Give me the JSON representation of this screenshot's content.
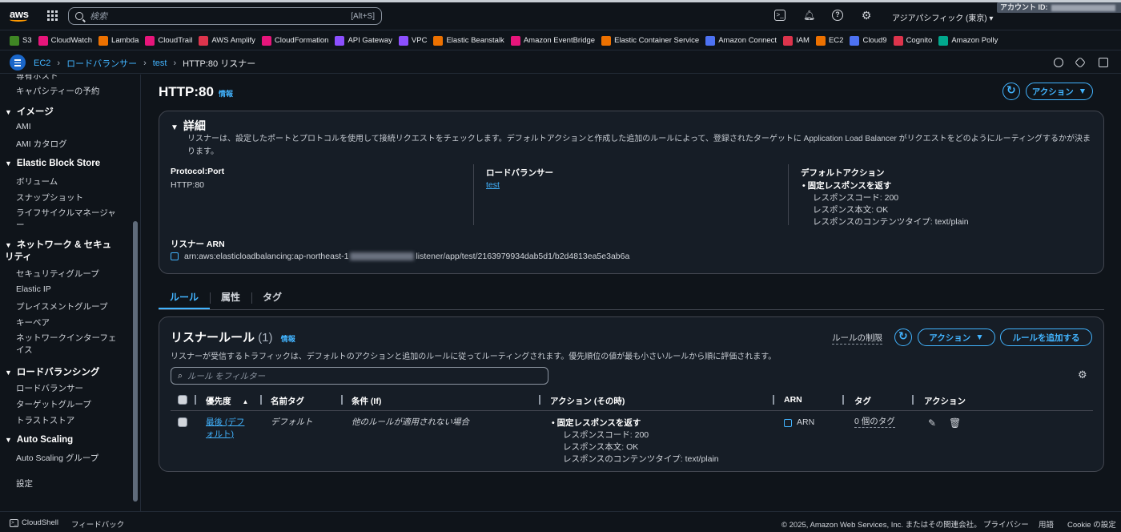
{
  "topbar": {
    "logo": "aws",
    "search_placeholder": "検索",
    "search_shortcut": "[Alt+S]",
    "region": "アジアパシフィック (東京) ▾",
    "account_label": "アカウント ID:"
  },
  "favorites": [
    {
      "label": "S3",
      "color": "#3f8624"
    },
    {
      "label": "CloudWatch",
      "color": "#e7157b"
    },
    {
      "label": "Lambda",
      "color": "#ed7100"
    },
    {
      "label": "CloudTrail",
      "color": "#e7157b"
    },
    {
      "label": "AWS Amplify",
      "color": "#dd344c"
    },
    {
      "label": "CloudFormation",
      "color": "#e7157b"
    },
    {
      "label": "API Gateway",
      "color": "#8c4fff"
    },
    {
      "label": "VPC",
      "color": "#8c4fff"
    },
    {
      "label": "Elastic Beanstalk",
      "color": "#ed7100"
    },
    {
      "label": "Amazon EventBridge",
      "color": "#e7157b"
    },
    {
      "label": "Elastic Container Service",
      "color": "#ed7100"
    },
    {
      "label": "Amazon Connect",
      "color": "#4d72f3"
    },
    {
      "label": "IAM",
      "color": "#dd344c"
    },
    {
      "label": "EC2",
      "color": "#ed7100"
    },
    {
      "label": "Cloud9",
      "color": "#4d72f3"
    },
    {
      "label": "Cognito",
      "color": "#dd344c"
    },
    {
      "label": "Amazon Polly",
      "color": "#01a88d"
    }
  ],
  "breadcrumb": {
    "items": [
      "EC2",
      "ロードバランサー",
      "test"
    ],
    "current": "HTTP:80 リスナー"
  },
  "sidebar": {
    "items": {
      "partial": "専有ホスト",
      "capacity": "キャパシティーの予約",
      "images_head": "イメージ",
      "ami": "AMI",
      "ami_catalog": "AMI カタログ",
      "ebs_head": "Elastic Block Store",
      "volumes": "ボリューム",
      "snapshots": "スナップショット",
      "lifecycle": "ライフサイクルマネージャー",
      "network_head": "ネットワーク & セキュリティ",
      "security_groups": "セキュリティグループ",
      "elastic_ip": "Elastic IP",
      "placement": "プレイスメントグループ",
      "keypairs": "キーペア",
      "network_interfaces": "ネットワークインターフェイス",
      "lb_head": "ロードバランシング",
      "load_balancers": "ロードバランサー",
      "target_groups": "ターゲットグループ",
      "trust_stores": "トラストストア",
      "as_head": "Auto Scaling",
      "as_groups": "Auto Scaling グループ",
      "settings": "設定"
    }
  },
  "page": {
    "title": "HTTP:80",
    "info": "情報",
    "actions": "アクション"
  },
  "details": {
    "title": "詳細",
    "description": "リスナーは、設定したポートとプロトコルを使用して接続リクエストをチェックします。デフォルトアクションと作成した追加のルールによって、登録されたターゲットに Application Load Balancer がリクエストをどのようにルーティングするかが決まります。",
    "protocol_port_label": "Protocol:Port",
    "protocol_port": "HTTP:80",
    "lb_label": "ロードバランサー",
    "lb_value": "test",
    "default_action_label": "デフォルトアクション",
    "default_action_title": "固定レスポンスを返す",
    "response_code": "レスポンスコード: 200",
    "response_body": "レスポンス本文: OK",
    "content_type": "レスポンスのコンテンツタイプ: text/plain",
    "arn_label": "リスナー ARN",
    "arn_prefix": "arn:aws:elasticloadbalancing:ap-northeast-1",
    "arn_suffix": "listener/app/test/2163979934dab5d1/b2d4813ea5e3ab6a"
  },
  "tabs": [
    "ルール",
    "属性",
    "タグ"
  ],
  "rules": {
    "title": "リスナールール",
    "count": "(1)",
    "info": "情報",
    "limit_link": "ルールの制限",
    "actions": "アクション",
    "add_rule": "ルールを追加する",
    "description": "リスナーが受信するトラフィックは、デフォルトのアクションと追加のルールに従ってルーティングされます。優先順位の値が最も小さいルールから順に評価されます。",
    "filter_placeholder": "ルール をフィルター",
    "columns": [
      "優先度",
      "名前タグ",
      "条件 (If)",
      "アクション (その時)",
      "ARN",
      "タグ",
      "アクション"
    ],
    "row": {
      "priority": "最後 (デフォルト)",
      "name": "デフォルト",
      "condition": "他のルールが適用されない場合",
      "action_title": "固定レスポンスを返す",
      "action_code": "レスポンスコード: 200",
      "action_body": "レスポンス本文: OK",
      "action_type": "レスポンスのコンテンツタイプ: text/plain",
      "arn": "ARN",
      "tags": "0 個のタグ"
    }
  },
  "footer": {
    "cloudshell": "CloudShell",
    "feedback": "フィードバック",
    "copyright": "© 2025, Amazon Web Services, Inc. またはその関連会社。",
    "privacy": "プライバシー",
    "terms": "用語",
    "cookie": "Cookie の設定"
  }
}
